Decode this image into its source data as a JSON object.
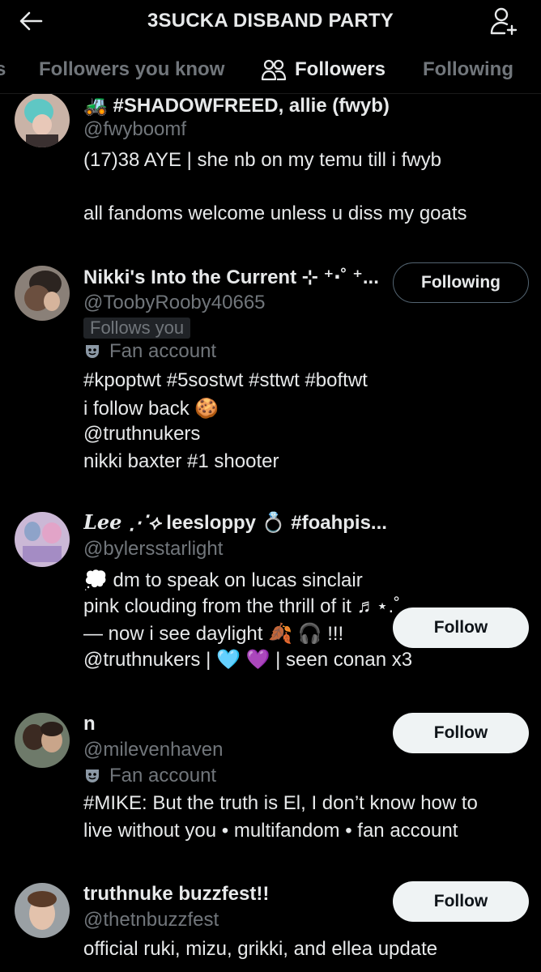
{
  "header": {
    "title": "3SUCKA DISBAND PARTY"
  },
  "tabs": {
    "partial": "s",
    "followers_you_know": "Followers you know",
    "followers": "Followers",
    "following": "Following"
  },
  "users": [
    {
      "name": "🚜 #SHADOWFREED, allie (fwyb)",
      "handle": "@fwyboomf",
      "bio": [
        "(17)38 AYE | she nb on my temu till i fwyb",
        "all fandoms welcome unless u diss my goats"
      ]
    },
    {
      "name": "Nikki's Into the Current ⊹ ⁺‧˚ ⁺...",
      "handle": "@ToobyRooby40665",
      "follows_you": "Follows you",
      "fan_account": "Fan account",
      "button": "Following",
      "bio": [
        "#kpoptwt #5sostwt #sttwt #boftwt",
        "i follow back 🍪",
        "@truthnukers",
        "nikki baxter #1 shooter"
      ]
    },
    {
      "name_script": "Lee ⋰⟡",
      "name_rest": " leesloppy 💍 #foahpis...",
      "handle": "@bylersstarlight",
      "button": "Follow",
      "bio": [
        "💭 dm to speak on lucas sinclair",
        "pink clouding from the thrill of it ♬⋆.˚",
        "— now i see daylight 🍂 🎧 !!!",
        "@truthnukers | 🩵 💜 | seen conan x3"
      ]
    },
    {
      "name": "n",
      "handle": "@milevenhaven",
      "fan_account": "Fan account",
      "button": "Follow",
      "bio": [
        "#MIKE: But the truth is El, I don’t know how to",
        "live without you • multifandom • fan account"
      ]
    },
    {
      "name": "truthnuke buzzfest!!",
      "handle": "@thetnbuzzfest",
      "button": "Follow",
      "bio": [
        "official ruki, mizu, grikki, and ellea update"
      ]
    }
  ]
}
